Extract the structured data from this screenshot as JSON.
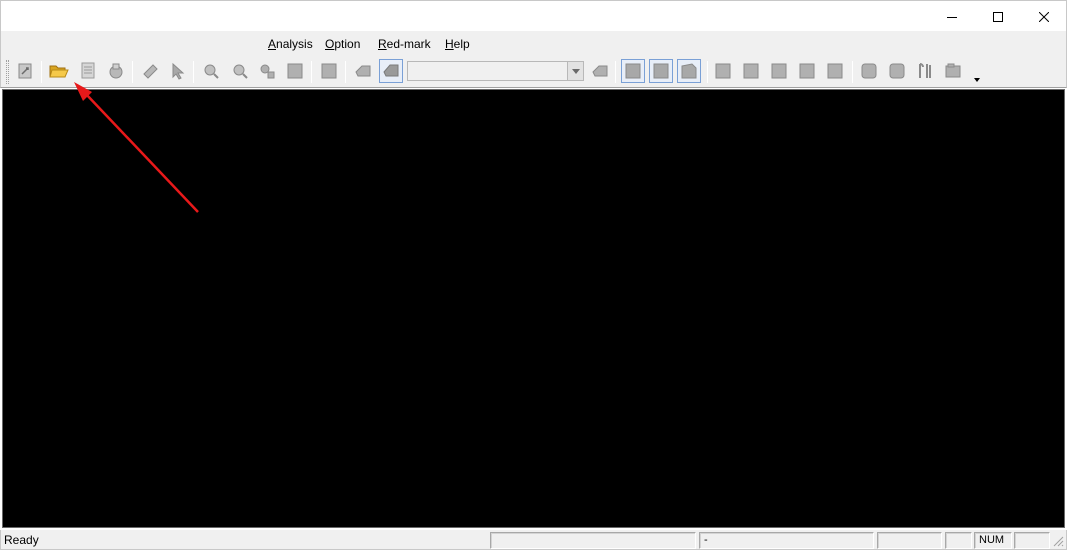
{
  "menu": {
    "analysis": {
      "accel": "A",
      "rest": "nalysis"
    },
    "option": {
      "accel": "O",
      "rest": "ption"
    },
    "redmark": {
      "accel": "R",
      "rest": "ed-mark"
    },
    "help": {
      "accel": "H",
      "rest": "elp"
    }
  },
  "toolbar": {
    "combo_value": ""
  },
  "status": {
    "text": "Ready",
    "pane1": "",
    "pane2": "-",
    "pane3": "",
    "pane4": "",
    "pane5": "NUM",
    "pane6": ""
  },
  "colors": {
    "annotation_arrow": "#e8191a",
    "view_background": "#000000",
    "open_folder": "#f0c040"
  }
}
